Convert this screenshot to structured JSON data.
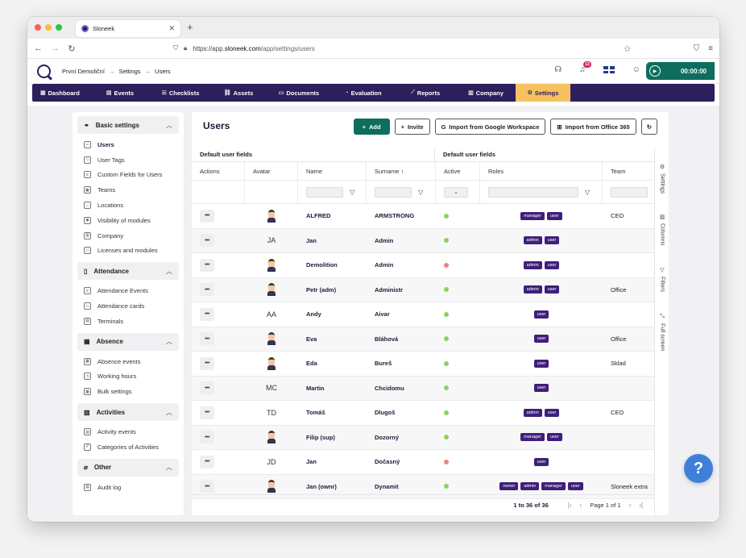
{
  "browser": {
    "tab_title": "Sloneek",
    "url_prefix": "https://app.",
    "url_host": "sloneek.com",
    "url_path": "/app/settings/users"
  },
  "header": {
    "breadcrumb": [
      "První Demoliční",
      "Settings",
      "Users"
    ],
    "notif_count": "13",
    "timer": "00:00:00"
  },
  "nav": [
    {
      "label": "Dashboard",
      "icon": "▦"
    },
    {
      "label": "Events",
      "icon": "▤"
    },
    {
      "label": "Checklists",
      "icon": "☰"
    },
    {
      "label": "Assets",
      "icon": "⛓"
    },
    {
      "label": "Documents",
      "icon": "▭"
    },
    {
      "label": "Evaluation",
      "icon": "◔"
    },
    {
      "label": "Reports",
      "icon": "⟋"
    },
    {
      "label": "Company",
      "icon": "▥"
    },
    {
      "label": "Settings",
      "icon": "⚙"
    }
  ],
  "sidebar": {
    "basic": {
      "title": "Basic settings",
      "items": [
        "Users",
        "User Tags",
        "Custom Fields for Users",
        "Teams",
        "Locations",
        "Visibility of modules",
        "Company",
        "Licenses and modules"
      ]
    },
    "attendance": {
      "title": "Attendance",
      "items": [
        "Attendance Events",
        "Attendance cards",
        "Terminals"
      ]
    },
    "absence": {
      "title": "Absence",
      "items": [
        "Absence events",
        "Working hours",
        "Bulk settings"
      ]
    },
    "activities": {
      "title": "Activities",
      "items": [
        "Activity events",
        "Categories of Activities"
      ]
    },
    "other": {
      "title": "Other",
      "items": [
        "Audit log"
      ]
    }
  },
  "panel": {
    "title": "Users",
    "add": "Add",
    "invite": "Invite",
    "import_google": "Import from Google Workspace",
    "import_office": "Import from Office 365"
  },
  "table": {
    "group_left": "Default user fields",
    "group_right": "Default user fields",
    "headers": [
      "Actions",
      "Avatar",
      "Name",
      "Surname",
      "Active",
      "Roles",
      "Team"
    ],
    "sort_arrow": "↑",
    "rows": [
      {
        "avatar": "img",
        "name": "ALFRED",
        "surname": "ARMSTRONG",
        "active": true,
        "roles": [
          "manager",
          "user"
        ],
        "team": "CEO"
      },
      {
        "avatar": "JA",
        "name": "Jan",
        "surname": "Admin",
        "active": true,
        "roles": [
          "admin",
          "user"
        ],
        "team": ""
      },
      {
        "avatar": "img",
        "name": "Demolition",
        "surname": "Admin",
        "active": false,
        "roles": [
          "admin",
          "user"
        ],
        "team": ""
      },
      {
        "avatar": "img",
        "name": "Petr (adm)",
        "surname": "Administr",
        "active": true,
        "roles": [
          "admin",
          "user"
        ],
        "team": "Office"
      },
      {
        "avatar": "AA",
        "name": "Andy",
        "surname": "Aivar",
        "active": true,
        "roles": [
          "user"
        ],
        "team": ""
      },
      {
        "avatar": "img",
        "name": "Eva",
        "surname": "Bláhová",
        "active": true,
        "roles": [
          "user"
        ],
        "team": "Office"
      },
      {
        "avatar": "img",
        "name": "Eda",
        "surname": "Bureš",
        "active": true,
        "roles": [
          "user"
        ],
        "team": "Sklad"
      },
      {
        "avatar": "MC",
        "name": "Martin",
        "surname": "Chcidomu",
        "active": true,
        "roles": [
          "user"
        ],
        "team": ""
      },
      {
        "avatar": "TD",
        "name": "Tomáš",
        "surname": "Dlugoš",
        "active": true,
        "roles": [
          "admin",
          "user"
        ],
        "team": "CEO"
      },
      {
        "avatar": "img",
        "name": "Filip (sup)",
        "surname": "Dozorný",
        "active": true,
        "roles": [
          "manager",
          "user"
        ],
        "team": ""
      },
      {
        "avatar": "JD",
        "name": "Jan",
        "surname": "Dočasný",
        "active": false,
        "roles": [
          "user"
        ],
        "team": ""
      },
      {
        "avatar": "img",
        "name": "Jan (ownr)",
        "surname": "Dynamit",
        "active": true,
        "roles": [
          "owner",
          "admin",
          "manager",
          "user"
        ],
        "team": "Sloneek extra"
      }
    ]
  },
  "pagination": {
    "range": "1 to 36 of 36",
    "page": "Page 1 of 1"
  },
  "side_tools": [
    "Settings",
    "Columns",
    "Filters",
    "Full screen"
  ],
  "colors": {
    "brand": "#2d1e5c",
    "accent": "#0d6e5e",
    "active_tab": "#f6c161",
    "role_badge": "#3e1f7a"
  }
}
